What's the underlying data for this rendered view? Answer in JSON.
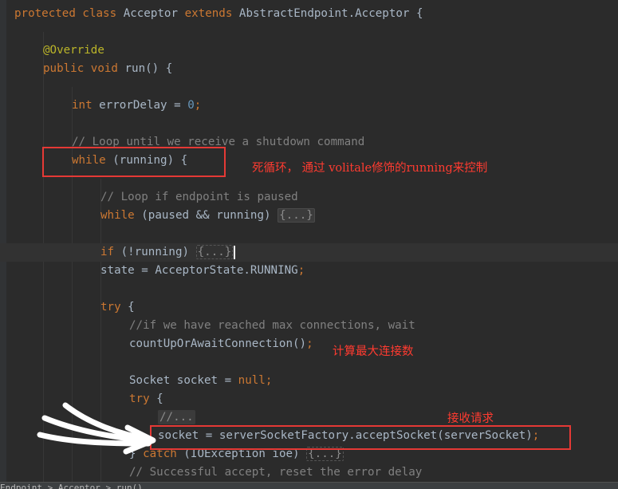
{
  "code": {
    "class_decl": {
      "kw1": "protected",
      "kw2": "class",
      "name": "Acceptor",
      "kw3": "extends",
      "parent": "AbstractEndpoint.Acceptor {"
    },
    "override": "@Override",
    "run_decl": {
      "kw1": "public",
      "kw2": "void",
      "rest": "run() {"
    },
    "error_delay": {
      "kw": "int",
      "name": "errorDelay = ",
      "val": "0",
      "end": ";"
    },
    "comment_loop": "// Loop until we receive a shutdown command",
    "while_running": {
      "kw": "while",
      "rest": "(running) {"
    },
    "comment_paused": "// Loop if endpoint is paused",
    "while_paused": {
      "kw": "while",
      "rest": "(paused && running) ",
      "fold": "{...}"
    },
    "if_running": {
      "kw": "if",
      "rest": "(!running) ",
      "fold": "{...}"
    },
    "state_line": "state = AcceptorState.RUNNING",
    "state_semi": ";",
    "try1": {
      "kw": "try",
      "rest": "{"
    },
    "comment_max": "//if we have reached max connections, wait",
    "count_up": "countUpOrAwaitConnection()",
    "count_up_semi": ";",
    "socket_decl": {
      "type": "Socket socket = ",
      "kw": "null",
      "semi": ";"
    },
    "try2": {
      "kw": "try",
      "rest": "{"
    },
    "comment_fold": "//...",
    "accept_line": "socket = serverSocketFactory.acceptSocket(serverSocket)",
    "accept_semi": ";",
    "catch_line": {
      "brace": "} ",
      "kw": "catch",
      "rest": "(IOException ioe) ",
      "fold": "{...}"
    },
    "comment_success": "// Successful accept, reset the error delay"
  },
  "annotations": {
    "while_note": "死循环， 通过 volitale修饰的running来控制",
    "count_note": "计算最大连接数",
    "accept_note": "接收请求"
  },
  "statusbar": {
    "breadcrumb": "Endpoint > Acceptor > run()"
  },
  "colors": {
    "background": "#2b2b2b",
    "keyword": "#cc7832",
    "comment": "#808080",
    "number": "#6897bb",
    "annotation": "#bbb529",
    "text": "#a9b7c6",
    "highlight_box": "#e53935"
  }
}
